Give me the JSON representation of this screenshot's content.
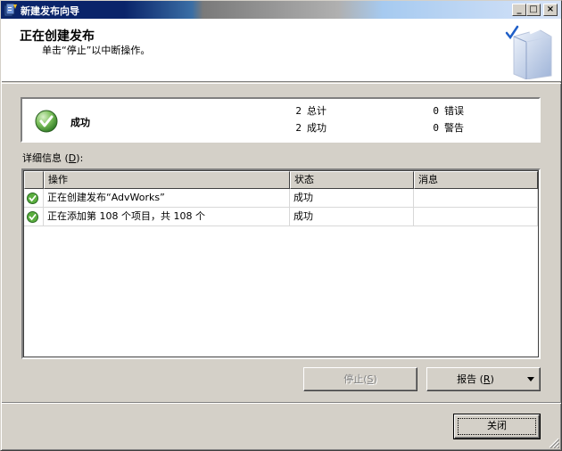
{
  "window": {
    "title": "新建发布向导",
    "controls": {
      "minimize": "_",
      "maximize": "□",
      "close": "×"
    }
  },
  "header": {
    "title": "正在创建发布",
    "subtitle": "单击“停止”以中断操作。",
    "icon": "wizard-book-check-icon"
  },
  "summary": {
    "status_icon": "success-check-icon",
    "status": "成功",
    "total_count": "2",
    "total_label": "总计",
    "success_count": "2",
    "success_label": "成功",
    "error_count": "0",
    "error_label": "错误",
    "warning_count": "0",
    "warning_label": "警告"
  },
  "details": {
    "label": "详细信息",
    "mnemonic": "D",
    "suffix": "):",
    "columns": [
      "操作",
      "状态",
      "消息"
    ],
    "rows": [
      {
        "icon": "success-check-icon",
        "action": "正在创建发布“AdvWorks”",
        "status": "成功",
        "message": ""
      },
      {
        "icon": "success-check-icon",
        "action": "正在添加第 108 个项目，共 108 个",
        "status": "成功",
        "message": ""
      }
    ]
  },
  "buttons": {
    "stop": "停止",
    "stop_mnemonic": "S",
    "report": "报告",
    "report_mnemonic": "R",
    "close": "关闭"
  },
  "colors": {
    "titlebar_active": "#0a246a",
    "dialog_face": "#d4d0c8",
    "success_green": "#3c9a2e"
  }
}
